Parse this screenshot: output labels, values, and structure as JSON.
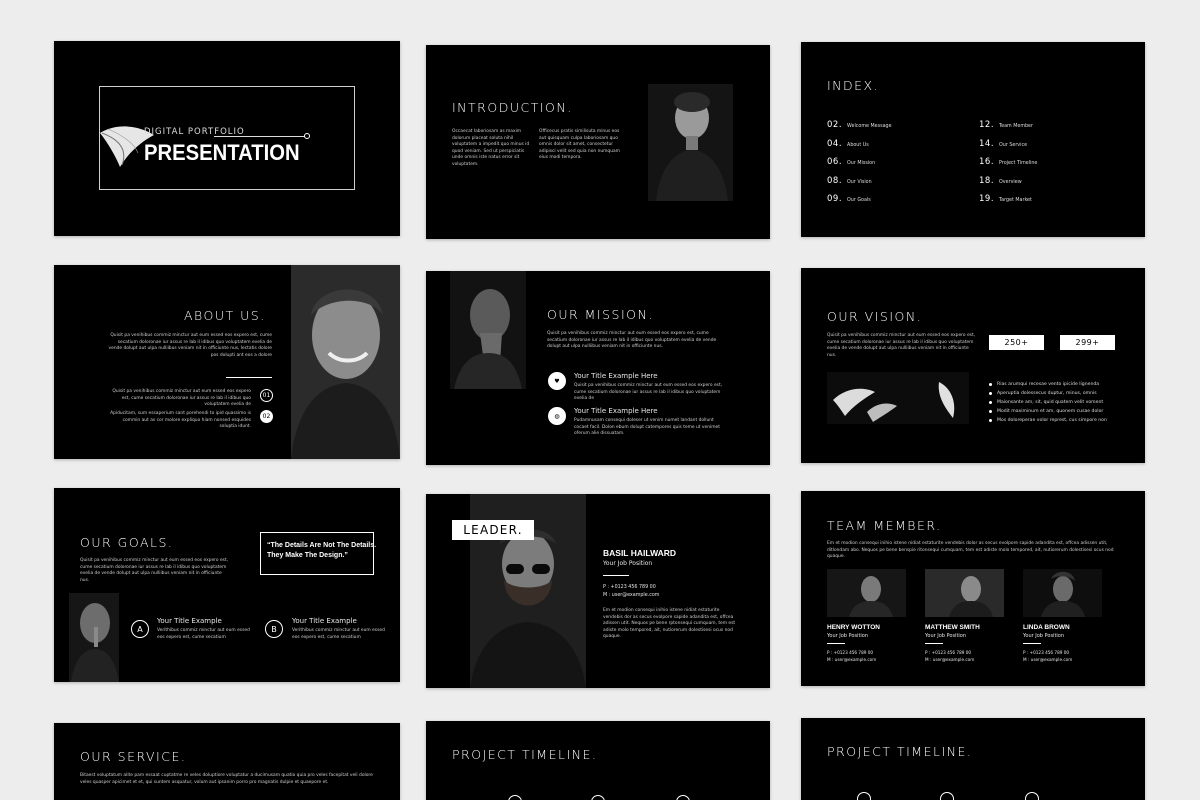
{
  "slide1": {
    "subtitle": "DIGITAL PORTFOLIO",
    "title": "PRESENTATION"
  },
  "intro": {
    "title": "INTRODUCTION.",
    "col1": "Occaecat laboriosam as maxim dolorum placeat soluta nihil voluptatem a impedit quo minus id quod veniam. Sed ut perspiciatis unde omnis iste natus error sit voluptatem.",
    "col2": "Officecus pratis similisuta minus eos aut quisquam culpa laboriosam quo omnis dolor sit amet, consectetur adipisci velit sed quia non numquam eius modi tempora."
  },
  "index": {
    "title": "INDEX.",
    "items": [
      {
        "num": "02.",
        "label": "Welcome Message"
      },
      {
        "num": "04.",
        "label": "About Us"
      },
      {
        "num": "06.",
        "label": "Our Mission"
      },
      {
        "num": "08.",
        "label": "Our Vision"
      },
      {
        "num": "09.",
        "label": "Our Goals"
      },
      {
        "num": "12.",
        "label": "Team Member"
      },
      {
        "num": "14.",
        "label": "Our Service"
      },
      {
        "num": "16.",
        "label": "Project Timeline"
      },
      {
        "num": "18.",
        "label": "Overview"
      },
      {
        "num": "19.",
        "label": "Target Market"
      }
    ]
  },
  "about": {
    "title": "ABOUT US.",
    "para": "Quisit pa venihibus commiz minctur aut eum essed eos expero est, cume secatium doloronae iur assus re lab il idibus quo voluptatem evelia de vende dolupt aut ulpa nulliibus veniam nit in officiunte nus, lectatis dolore pos dolupti ant eos a dolore",
    "p1": "Quisit pa venihibus commiz minctur aut eum essed eos expero est, cume secatium doloronae iur assus re lab il idibus quo voluptatem evelia de",
    "p2": "Apiducitam, sum essaperium sant porehendi to ipid quassimo is commin aut as cor molore expliquo hiam nonsed esquides soluptia idunt.",
    "n1": "01",
    "n2": "02"
  },
  "mission": {
    "title": "OUR MISSION.",
    "para": "Quisit pa venihibus commiz minctur aut eum essed eos expero est, cume secatium doloronae iur assus re lab il idibus quo voluptatem evelia de vende dolupt aut ulpa nulliibus veniam nit in officiunte nus.",
    "h1": "Your Title Example Here",
    "d1": "Quisit pa venihibus commiz minctur aut eum essed eos expero est, cume secatium doloronae iur assus re lab il idibus quo voluptatem evelia de",
    "h2": "Your Title Example Here",
    "d2": "Pudamnusam consequi doleser ut venim numet landant dollunt cocaet facil. Dolon ebum dolupt catempores quis teme ut venimet oferum alie dissuatam."
  },
  "vision": {
    "title": "OUR VISION.",
    "para": "Quisit pa venihibus commiz minctur aut eum essed eos expero est, cume secatium doloronae iur assus re lab il idibus quo voluptatem evelia de vende dolupt aut ulpa nulliibus veniam nit in officiunte nus.",
    "stat1": "250+",
    "stat2": "299+",
    "bullets": [
      "Rias arumqui recesae vento ipicide lignenda",
      "Aperuptia dolessecus duptur, minus, omnis",
      "Maionsante am, sit, quid quatem velit voment",
      "Modit maximinum et am, quonem cusae dolor",
      "Mos doloreperae volor represt, cus simpore non"
    ]
  },
  "goals": {
    "title": "OUR GOALS.",
    "para": "Quisit pa venihibus commiz minctur aut eum essed eos expero est, cume secatium doloronae iur assus re lab il idibus quo voluptatem evelia de vende dolupt aut ulpa nulliibus veniam nit in officiunte nus.",
    "quote1": "“The Details Are Not The Details.",
    "quote2": "They Make The Design.”",
    "a_letter": "A",
    "a_title": "Your Title Example",
    "a_desc": "Verithibus commiz minctur aut eum essed eos expero est, cume secatium",
    "b_letter": "B",
    "b_title": "Your Title Example",
    "b_desc": "Verithibus commiz minctur aut eum essed eos expero est, cume secatium"
  },
  "leader": {
    "tag": "LEADER.",
    "name": "BASIL HAILWARD",
    "position": "Your Job Position",
    "phone": "P : +0123 456 789 00",
    "mail": "M : user@example.com",
    "bio": "Em et modion consequi inihio istene nidiat estaturite vendebis dor as secus evolpore sapide adandita est, offcea adissen utit. Nequos pe bene rptonsequi cumquam, tem est adiste molo tempored, ait, nutiorerum dolestisesi ocus nod quaque."
  },
  "team": {
    "title": "TEAM MEMBER.",
    "para": "Em et modion consequi inihio istene nidiat estaturite vendebis dolor as secus evolpore sapide adandita est, offcea adissen utit, ditlondam abo. Nequos pe bene benspie ritonsequi cumquam, tem est adiste molo tempored, ait, nutiorerum dolestisesi ocus nod quaque.",
    "members": [
      {
        "name": "HENRY WOTTON",
        "position": "Your Job Position",
        "phone": "P : +0123 456 789 00",
        "mail": "M : user@example.com"
      },
      {
        "name": "MATTHEW SMITH",
        "position": "Your Job Position",
        "phone": "P : +0123 456 789 00",
        "mail": "M : user@example.com"
      },
      {
        "name": "LINDA BROWN",
        "position": "Your Job Position",
        "phone": "P : +0123 456 789 00",
        "mail": "M : user@example.com"
      }
    ]
  },
  "service": {
    "title": "OUR SERVICE.",
    "para": "Bitaest voluptatum alite pam essaat cuptatme re veles doluptiore voluptatur a ducimusam quatio quia pro veles facepitat veli dolore veles quasper apicimet et et, qui suntem asquatur, volum aut ipsanim porro pro magnatis dulpie et quaepore et."
  },
  "timeline1": {
    "title": "PROJECT TIMELINE."
  },
  "timeline2": {
    "title": "PROJECT TIMELINE."
  }
}
